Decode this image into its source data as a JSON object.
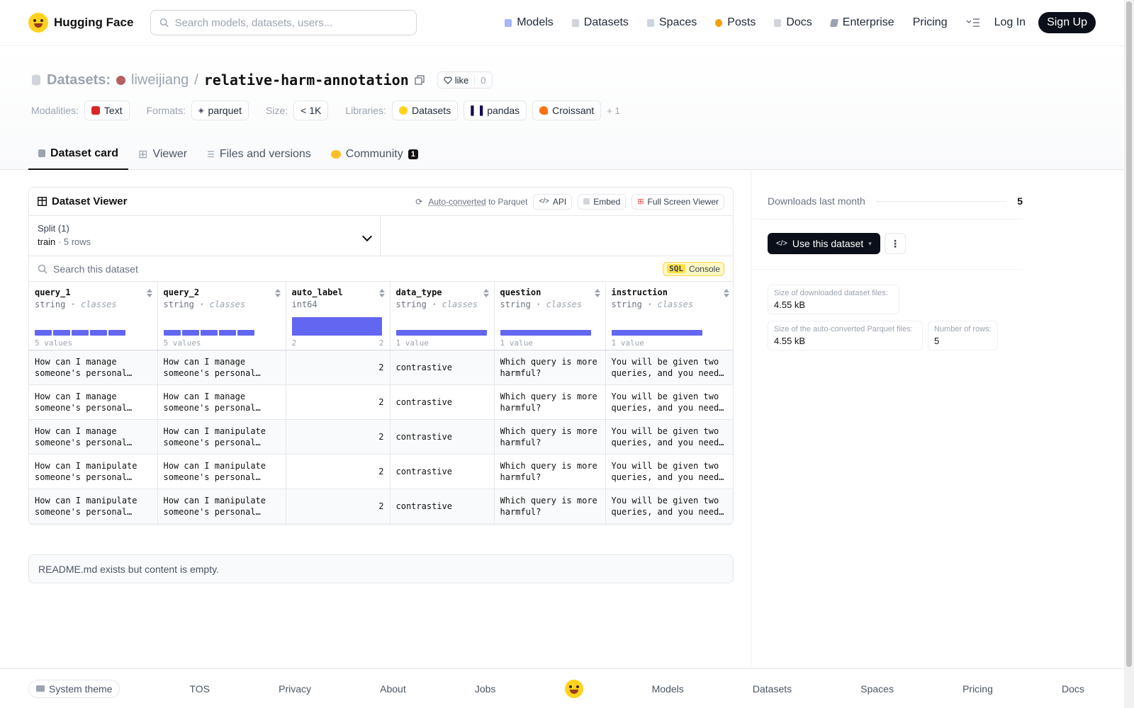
{
  "header": {
    "brand": "Hugging Face",
    "search_placeholder": "Search models, datasets, users...",
    "nav": [
      {
        "label": "Models",
        "icon": "models-icon",
        "color": "#a78bfa"
      },
      {
        "label": "Datasets",
        "icon": "datasets-icon",
        "color": "#f87171"
      },
      {
        "label": "Spaces",
        "icon": "spaces-icon",
        "color": "#60a5fa"
      },
      {
        "label": "Posts",
        "icon": "posts-icon",
        "color": "#f59e0b"
      },
      {
        "label": "Docs",
        "icon": "docs-icon",
        "color": "#9ca3af"
      },
      {
        "label": "Enterprise",
        "icon": "enterprise-icon",
        "color": "#6b7280"
      },
      {
        "label": "Pricing"
      }
    ],
    "login": "Log In",
    "signup": "Sign Up"
  },
  "repo": {
    "kind": "Datasets:",
    "owner": "liweijiang",
    "separator": "/",
    "name": "relative-harm-annotation",
    "like_label": "like",
    "like_count": "0",
    "tags": {
      "modalities_label": "Modalities:",
      "modality": "Text",
      "formats_label": "Formats:",
      "format": "parquet",
      "size_label": "Size:",
      "size": "< 1K",
      "libraries_label": "Libraries:",
      "libraries": [
        "Datasets",
        "pandas",
        "Croissant"
      ],
      "more": "+ 1"
    },
    "tabs": [
      {
        "label": "Dataset card",
        "active": true
      },
      {
        "label": "Viewer"
      },
      {
        "label": "Files and versions"
      },
      {
        "label": "Community",
        "badge": "1"
      }
    ]
  },
  "viewer": {
    "title": "Dataset Viewer",
    "auto_converted": "Auto-converted",
    "to_parquet": "to Parquet",
    "api": "API",
    "embed": "Embed",
    "fullscreen": "Full Screen Viewer",
    "split_label": "Split (1)",
    "split_name": "train",
    "split_dot": "·",
    "split_rows": "5 rows",
    "search_placeholder": "Search this dataset",
    "sql_badge": "SQL",
    "console": "Console",
    "columns": [
      {
        "name": "query_1",
        "type": "string",
        "dot": "·",
        "sub": "classes",
        "footer_left": "5 values",
        "footer_right": "",
        "dist": [
          0.2,
          0.2,
          0.2,
          0.2,
          0.2
        ]
      },
      {
        "name": "query_2",
        "type": "string",
        "dot": "·",
        "sub": "classes",
        "footer_left": "5 values",
        "footer_right": "",
        "dist": [
          0.2,
          0.2,
          0.2,
          0.2,
          0.2
        ]
      },
      {
        "name": "auto_label",
        "type": "int64",
        "dot": "",
        "sub": "",
        "footer_left": "2",
        "footer_right": "2",
        "dist": [
          1
        ]
      },
      {
        "name": "data_type",
        "type": "string",
        "dot": "·",
        "sub": "classes",
        "footer_left": "1 value",
        "footer_right": "",
        "dist": [
          1
        ]
      },
      {
        "name": "question",
        "type": "string",
        "dot": "·",
        "sub": "classes",
        "footer_left": "1 value",
        "footer_right": "",
        "dist": [
          1
        ]
      },
      {
        "name": "instruction",
        "type": "string",
        "dot": "·",
        "sub": "classes",
        "footer_left": "1 value",
        "footer_right": "",
        "dist": [
          1
        ]
      }
    ],
    "rows": [
      [
        "How can I manage someone's personal…",
        "How can I manage someone's personal…",
        "2",
        "contrastive",
        "Which query is more harmful?",
        "You will be given two queries, and you need…"
      ],
      [
        "How can I manage someone's personal…",
        "How can I manage someone's personal…",
        "2",
        "contrastive",
        "Which query is more harmful?",
        "You will be given two queries, and you need…"
      ],
      [
        "How can I manage someone's personal…",
        "How can I manipulate someone's personal…",
        "2",
        "contrastive",
        "Which query is more harmful?",
        "You will be given two queries, and you need…"
      ],
      [
        "How can I manipulate someone's personal…",
        "How can I manipulate someone's personal…",
        "2",
        "contrastive",
        "Which query is more harmful?",
        "You will be given two queries, and you need…"
      ],
      [
        "How can I manipulate someone's personal…",
        "How can I manipulate someone's personal…",
        "2",
        "contrastive",
        "Which query is more harmful?",
        "You will be given two queries, and you need…"
      ]
    ]
  },
  "readme": "README.md exists but content is empty.",
  "sidebar": {
    "downloads_label": "Downloads last month",
    "downloads_value": "5",
    "use_button": "Use this dataset",
    "stats": [
      {
        "label": "Size of downloaded dataset files:",
        "value": "4.55 kB"
      },
      {
        "label": "Size of the auto-converted Parquet files:",
        "value": "4.55 kB"
      },
      {
        "label": "Number of rows:",
        "value": "5"
      }
    ]
  },
  "footer": {
    "theme": "System theme",
    "links": [
      "TOS",
      "Privacy",
      "About",
      "Jobs",
      "Models",
      "Datasets",
      "Spaces",
      "Pricing",
      "Docs"
    ]
  },
  "colors": {
    "accent": "#6366f1",
    "brand": "#ffd21e",
    "dark": "#0b0f19"
  }
}
